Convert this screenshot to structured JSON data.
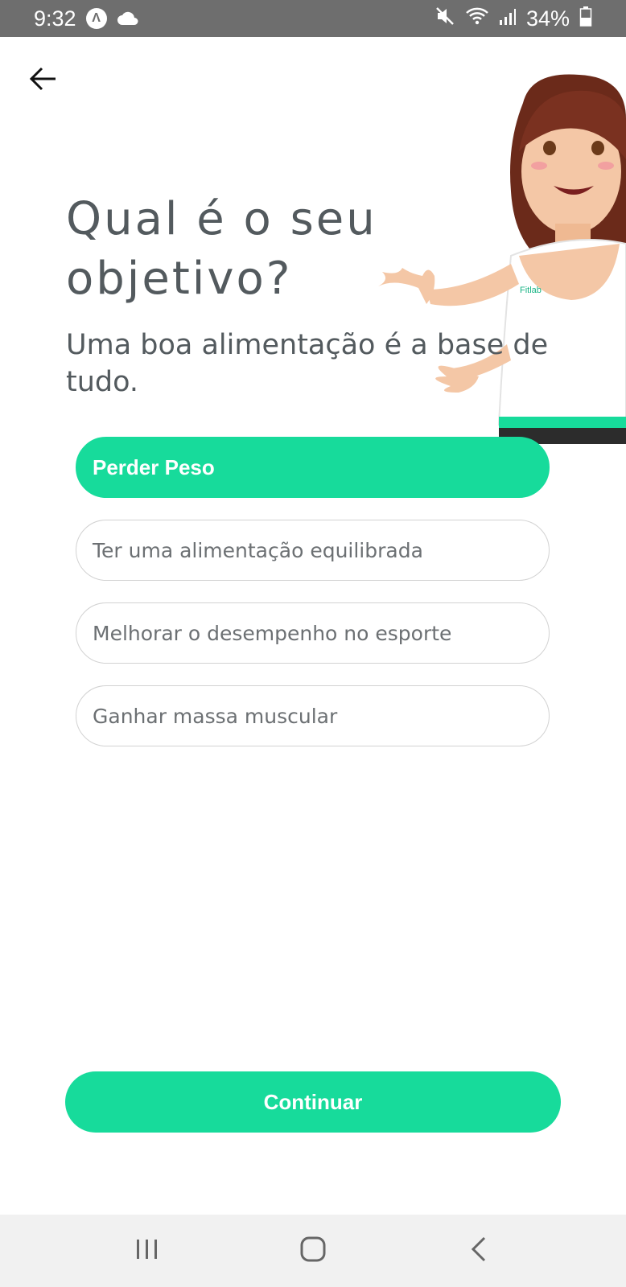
{
  "status_bar": {
    "time": "9:32",
    "badge_letter": "Λ",
    "battery": "34%",
    "icons": [
      "cloud-icon",
      "mute-icon",
      "wifi-icon",
      "signal-icon",
      "battery-icon"
    ]
  },
  "header": {
    "back_icon": "arrow-left-icon"
  },
  "main": {
    "title": "Qual é o seu objetivo?",
    "subtitle": "Uma boa alimentação é a base de tudo.",
    "illustration_brand": "Fitlab",
    "options": [
      {
        "label": "Perder Peso",
        "selected": true
      },
      {
        "label": "Ter uma alimentação equilibrada",
        "selected": false
      },
      {
        "label": "Melhorar o desempenho no esporte",
        "selected": false
      },
      {
        "label": "Ganhar massa muscular",
        "selected": false
      }
    ],
    "continue_label": "Continuar"
  },
  "nav_bar": {
    "icons": [
      "recent-apps-icon",
      "home-icon",
      "back-icon"
    ]
  },
  "colors": {
    "accent": "#17db9b",
    "text": "#535a5e",
    "status_bar": "#6e6e6e"
  }
}
